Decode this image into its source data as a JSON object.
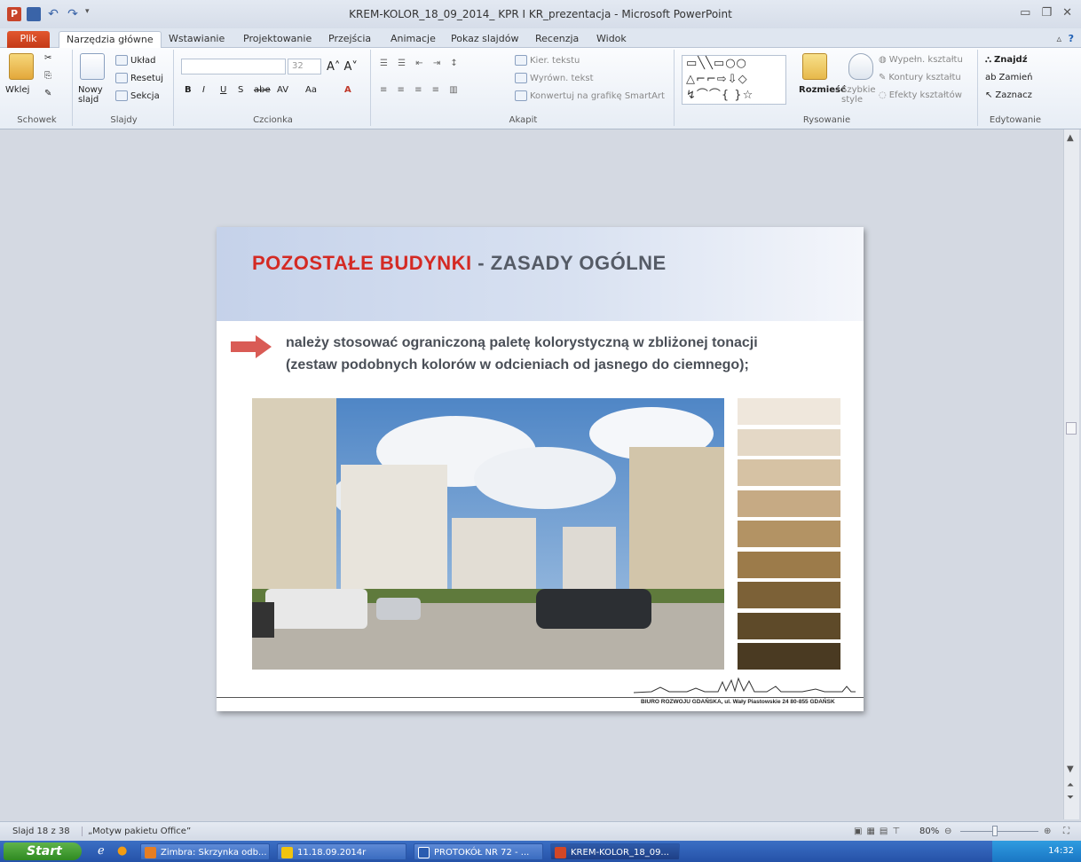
{
  "window": {
    "title": "KREM-KOLOR_18_09_2014_ KPR I KR_prezentacja  -  Microsoft PowerPoint"
  },
  "tabs": [
    "Plik",
    "Narzędzia główne",
    "Wstawianie",
    "Projektowanie",
    "Przejścia",
    "Animacje",
    "Pokaz slajdów",
    "Recenzja",
    "Widok"
  ],
  "ribbon": {
    "clipboard": {
      "paste": "Wklej",
      "label": "Schowek"
    },
    "slides": {
      "new_slide": "Nowy slajd",
      "layout": "Układ",
      "reset": "Resetuj",
      "section": "Sekcja",
      "label": "Slajdy"
    },
    "font": {
      "size": "32",
      "bold": "B",
      "italic": "I",
      "underline": "U",
      "shadow": "S",
      "strike": "abe",
      "spacing": "AV",
      "case": "Aa",
      "label": "Czcionka"
    },
    "paragraph": {
      "text_dir": "Kier. tekstu",
      "align_text": "Wyrówn. tekst",
      "smartart": "Konwertuj na grafikę SmartArt",
      "label": "Akapit"
    },
    "drawing": {
      "arrange": "Rozmieść",
      "quick_styles": "Szybkie style",
      "fill": "Wypełn. kształtu",
      "outline": "Kontury kształtu",
      "effects": "Efekty kształtów",
      "label": "Rysowanie"
    },
    "editing": {
      "find": "Znajdź",
      "replace": "Zamień",
      "select": "Zaznacz",
      "label": "Edytowanie"
    }
  },
  "slide": {
    "title_red": "POZOSTAŁE BUDYNKI",
    "title_rest": " - ZASADY OGÓLNE",
    "bullet_line1": "należy stosować ograniczoną paletę kolorystyczną w zbliżonej tonacji",
    "bullet_line2": "(zestaw podobnych kolorów w odcieniach od jasnego do ciemnego);",
    "footer": "BIURO ROZWOJU GDAŃSKA, ul. Wały Piastowskie 24  80-855 GDAŃSK",
    "swatch_colors": [
      "#efe7dc",
      "#e4d8c6",
      "#d6c2a4",
      "#c6aa84",
      "#b39364",
      "#9c7b4a",
      "#7c6137",
      "#5e4a29",
      "#4a3a22"
    ]
  },
  "status": {
    "slide_info": "Slajd 18 z 38",
    "theme": "„Motyw pakietu Office”",
    "zoom": "80%"
  },
  "taskbar": {
    "start": "Start",
    "items": [
      "Zimbra: Skrzynka odb...",
      "11.18.09.2014r",
      "PROTOKÓŁ NR 72 - ...",
      "KREM-KOLOR_18_09..."
    ],
    "clock": "14:32"
  }
}
